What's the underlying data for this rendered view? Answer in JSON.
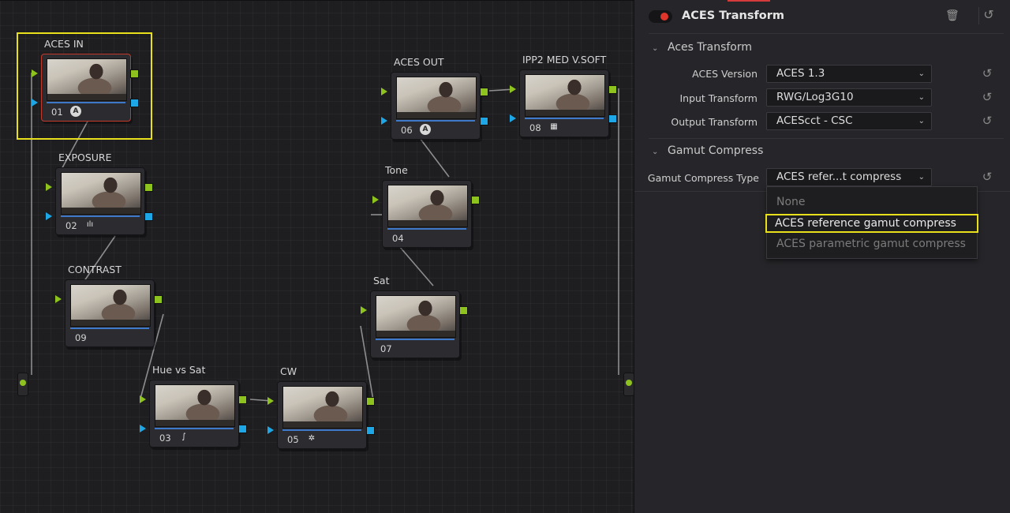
{
  "nodes": [
    {
      "label": "ACES IN",
      "num": "01",
      "icon": "aces-logo-icon",
      "icon_glyph": "A"
    },
    {
      "label": "EXPOSURE",
      "num": "02",
      "icon": "histogram-icon",
      "icon_glyph": "ılı"
    },
    {
      "label": "CONTRAST",
      "num": "09",
      "icon": "",
      "icon_glyph": ""
    },
    {
      "label": "Hue vs Sat",
      "num": "03",
      "icon": "curves-icon",
      "icon_glyph": "∫"
    },
    {
      "label": "CW",
      "num": "05",
      "icon": "color-wheel-icon",
      "icon_glyph": "✲"
    },
    {
      "label": "Sat",
      "num": "07",
      "icon": "",
      "icon_glyph": ""
    },
    {
      "label": "Tone",
      "num": "04",
      "icon": "",
      "icon_glyph": ""
    },
    {
      "label": "ACES OUT",
      "num": "06",
      "icon": "aces-logo-icon",
      "icon_glyph": "A"
    },
    {
      "label": "IPP2 MED V.SOFT",
      "num": "08",
      "icon": "lut-grid-icon",
      "icon_glyph": "▦"
    }
  ],
  "inspector": {
    "title": "ACES Transform",
    "enabled_color": "#e0352b",
    "trash_icon": "trash-icon",
    "reset_icon": "reset-icon",
    "sections": {
      "aces_transform": {
        "title": "Aces Transform",
        "aces_version_label": "ACES Version",
        "aces_version_value": "ACES 1.3",
        "input_transform_label": "Input Transform",
        "input_transform_value": "RWG/Log3G10",
        "output_transform_label": "Output Transform",
        "output_transform_value": "ACEScct - CSC"
      },
      "gamut_compress": {
        "title": "Gamut Compress",
        "type_label": "Gamut Compress Type",
        "type_value": "ACES refer...t compress",
        "options": [
          "None",
          "ACES reference gamut compress",
          "ACES parametric gamut compress"
        ],
        "highlighted_option": "ACES reference gamut compress"
      }
    }
  },
  "colors": {
    "selection_highlight": "#e8e01a",
    "port_green": "#8dc21f",
    "port_blue": "#1ea7e6"
  }
}
